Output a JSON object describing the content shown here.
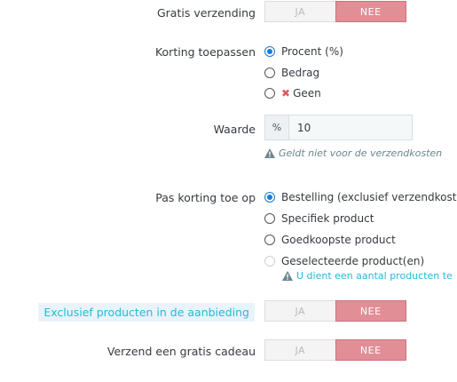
{
  "free_shipping": {
    "label": "Gratis verzending",
    "yes": "JA",
    "no": "NEE"
  },
  "apply_discount": {
    "label": "Korting toepassen",
    "options": [
      "Procent (%)",
      "Bedrag",
      "Geen"
    ],
    "selected": "Procent (%)"
  },
  "value": {
    "label": "Waarde",
    "addon": "%",
    "input_value": "10",
    "help": "Geldt niet voor de verzendkosten"
  },
  "apply_to": {
    "label": "Pas korting toe op",
    "options": [
      "Bestelling (exclusief verzendkosten)",
      "Specifiek product",
      "Goedkoopste product",
      "Geselecteerde product(en)"
    ],
    "selected": "Bestelling (exclusief verzendkosten)",
    "warning": "U dient een aantal producten te"
  },
  "exclude_discounted": {
    "label": "Exclusief producten in de aanbieding",
    "yes": "JA",
    "no": "NEE"
  },
  "free_gift": {
    "label": "Verzend een gratis cadeau",
    "yes": "JA",
    "no": "NEE"
  },
  "colors": {
    "toggle_active": "#e28e97",
    "radio_checked": "#1a7dd0",
    "link": "#25b9d7"
  }
}
